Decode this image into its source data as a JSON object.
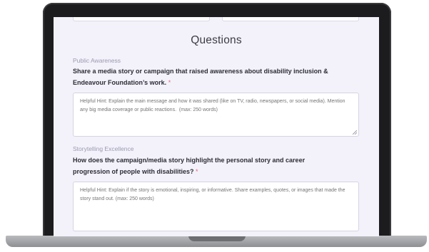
{
  "form": {
    "section_title": "Questions",
    "questions": [
      {
        "category": "Public Awareness",
        "question_line1": "Share a media story or campaign that raised awareness about disability inclusion &",
        "question_line2": "Endeavour Foundation’s work.",
        "required_marker": "*",
        "placeholder": "Helpful Hint: Explain the main message and how it was shared (like on TV, radio, newspapers, or social media). Mention any big media coverage or public reactions.  (max: 250 words)"
      },
      {
        "category": "Storytelling Excellence",
        "question_line1": "How does the campaign/media story highlight the personal story and career",
        "question_line2": "progression of people with disabilities?",
        "required_marker": "*",
        "placeholder": "Helpful Hint: Explain if the story is emotional, inspiring, or informative. Share examples, quotes, or images that made the story stand out. (max: 250 words)"
      }
    ]
  },
  "icons": {
    "resize_handle": "resize-grip-icon"
  },
  "colors": {
    "screen_background": "#f3f2fb",
    "required_marker": "#e06a78",
    "laptop_bezel": "#1c1c1e",
    "laptop_base": "#a5a6aa"
  }
}
